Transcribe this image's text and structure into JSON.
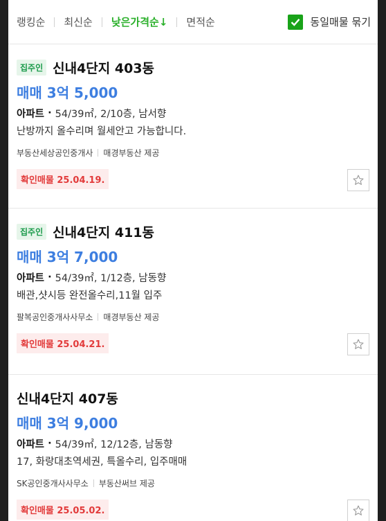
{
  "sortbar": {
    "options": [
      "랭킹순",
      "최신순",
      "낮은가격순↓",
      "면적순"
    ],
    "group_same_label": "동일매물 묶기"
  },
  "listings": [
    {
      "badge": "집주인",
      "title": "신내4단지 403동",
      "deal_type": "매매",
      "price": "3억 5,000",
      "property_type": "아파트",
      "spec": "54/39㎡, 2/10층, 남서향",
      "description": "난방까지 올수리며 월세안고 가능합니다.",
      "agent": "부동산세상공인중개사",
      "provider": "매경부동산 제공",
      "confirmed": "확인매물 25.04.19."
    },
    {
      "badge": "집주인",
      "title": "신내4단지 411동",
      "deal_type": "매매",
      "price": "3억 7,000",
      "property_type": "아파트",
      "spec": "54/39㎡, 1/12층, 남동향",
      "description": "배관,샷시등 완전올수리,11월 입주",
      "agent": "팔복공인중개사사무소",
      "provider": "매경부동산 제공",
      "confirmed": "확인매물 25.04.21."
    },
    {
      "badge": "",
      "title": "신내4단지 407동",
      "deal_type": "매매",
      "price": "3억 9,000",
      "property_type": "아파트",
      "spec": "54/39㎡, 12/12층, 남동향",
      "description": "17, 화랑대초역세권, 특올수리, 입주매매",
      "agent": "SK공인중개사사무소",
      "provider": "부동산써브 제공",
      "confirmed": "확인매물 25.05.02."
    }
  ],
  "icons": {
    "checkbox": "check-icon",
    "favorite": "star-icon"
  },
  "colors": {
    "accent_green": "#2bb02b",
    "price_blue": "#3d7ee0",
    "confirm_red": "#e23b3b"
  }
}
